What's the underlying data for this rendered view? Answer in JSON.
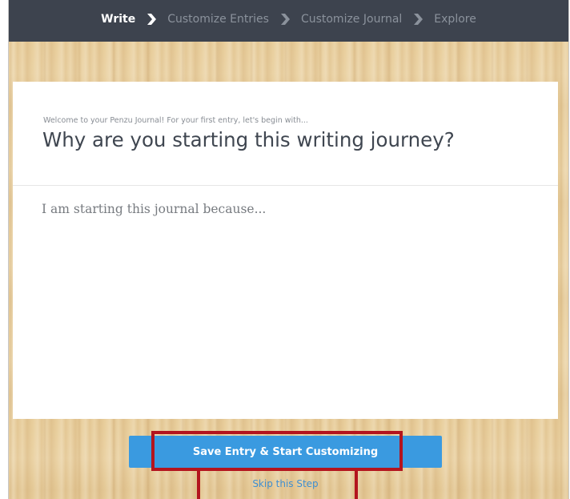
{
  "wizard": {
    "steps": [
      {
        "label": "Write",
        "active": true
      },
      {
        "label": "Customize Entries",
        "active": false
      },
      {
        "label": "Customize Journal",
        "active": false
      },
      {
        "label": "Explore",
        "active": false
      }
    ]
  },
  "prompt": {
    "intro": "Welcome to your Penzu Journal! For your first entry, let's begin with...",
    "question": "Why are you starting this writing journey?"
  },
  "entry": {
    "value": "",
    "placeholder": "I am starting this journal because..."
  },
  "actions": {
    "save_label": "Save Entry & Start Customizing",
    "skip_label": "Skip this Step"
  },
  "colors": {
    "topbar": "#3d434e",
    "step_active": "#ffffff",
    "step_inactive": "#8b929c",
    "accent": "#3a9ae0",
    "link": "#3f8fd1",
    "highlight": "#b3141e"
  },
  "icons": {
    "step_separator": "chevron-right-icon"
  }
}
